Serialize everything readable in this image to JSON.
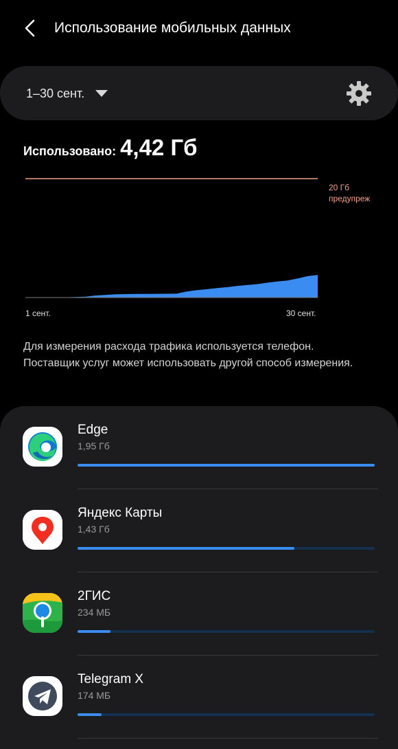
{
  "header": {
    "title": "Использование мобильных данных",
    "back_icon": "back-arrow-icon"
  },
  "period": {
    "label": "1–30 сент.",
    "dropdown_icon": "caret-down-icon",
    "settings_icon": "gear-icon"
  },
  "usage": {
    "label": "Использовано:",
    "value": "4,42 Гб"
  },
  "chart_data": {
    "type": "area",
    "x_start_label": "1 сент.",
    "x_end_label": "30 сент.",
    "warning_line": {
      "value": 20,
      "unit": "Гб",
      "label_line1": "20 Гб",
      "label_line2": "предупреж"
    },
    "ylim": [
      0,
      20
    ],
    "x": [
      1,
      5,
      7,
      8,
      10,
      12,
      14,
      16,
      17,
      18,
      19,
      20,
      21,
      22,
      23,
      24,
      25,
      26,
      27,
      28,
      29,
      30
    ],
    "values": [
      0.0,
      0.05,
      0.15,
      0.35,
      0.55,
      0.6,
      0.62,
      0.65,
      1.0,
      1.25,
      1.4,
      1.6,
      1.75,
      1.95,
      2.1,
      2.25,
      2.5,
      2.7,
      2.85,
      3.2,
      3.6,
      3.8
    ],
    "colors": {
      "area": "#3b8cf0",
      "warning": "#f1a088",
      "baseline": "#7a7a7a"
    }
  },
  "note": "Для измерения расхода трафика используется телефон. Поставщик услуг может использовать другой способ измерения.",
  "apps": [
    {
      "name": "Edge",
      "size": "1,95 Гб",
      "fraction": 1.0,
      "icon": "edge-icon"
    },
    {
      "name": "Яндекс Карты",
      "size": "1,43 Гб",
      "fraction": 0.73,
      "icon": "yandex-maps-icon"
    },
    {
      "name": "2ГИС",
      "size": "234 МБ",
      "fraction": 0.11,
      "icon": "2gis-icon"
    },
    {
      "name": "Telegram X",
      "size": "174 МБ",
      "fraction": 0.08,
      "icon": "telegram-icon"
    }
  ]
}
